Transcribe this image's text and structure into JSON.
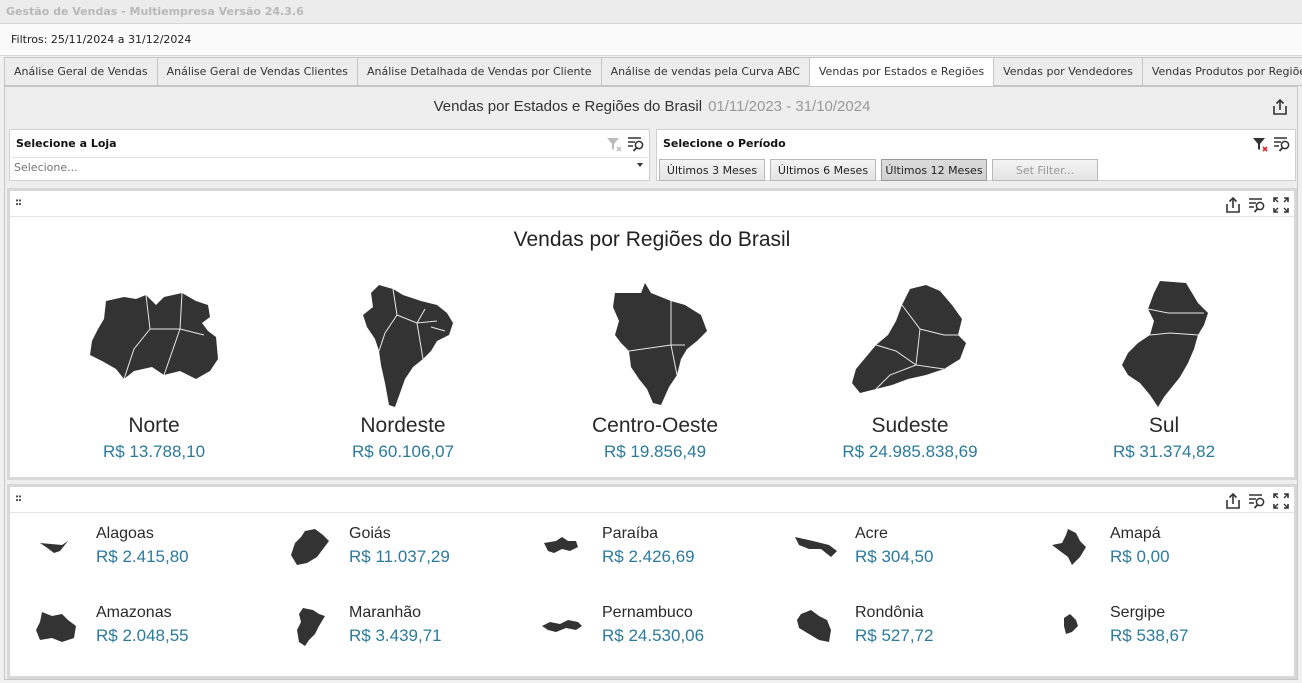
{
  "window": {
    "title": "Gestão de Vendas - Multiempresa Versão 24.3.6"
  },
  "filters": {
    "text": "Filtros: 25/11/2024 a 31/12/2024"
  },
  "tabs": [
    {
      "label": "Análise Geral de Vendas"
    },
    {
      "label": "Análise Geral de Vendas Clientes"
    },
    {
      "label": "Análise Detalhada de Vendas por Cliente"
    },
    {
      "label": "Análise de vendas pela Curva ABC"
    },
    {
      "label": "Vendas por Estados e Regiões",
      "active": true
    },
    {
      "label": "Vendas por Vendedores"
    },
    {
      "label": "Vendas Produtos por Regiões"
    }
  ],
  "dashboard": {
    "title": "Vendas por Estados e Regiões do Brasil",
    "period": "01/11/2023 - 31/10/2024"
  },
  "store_filter": {
    "title": "Selecione a Loja",
    "placeholder": "Selecione..."
  },
  "period_filter": {
    "title": "Selecione o Período",
    "buttons": [
      "Últimos 3 Meses",
      "Últimos 6 Meses",
      "Últimos 12 Meses",
      "Set Filter..."
    ],
    "selected": "Últimos 12 Meses"
  },
  "regions_panel": {
    "title": "Vendas por Regiões do Brasil",
    "regions": [
      {
        "name": "Norte",
        "value": "R$ 13.788,10",
        "icon": "norte-map-icon"
      },
      {
        "name": "Nordeste",
        "value": "R$ 60.106,07",
        "icon": "nordeste-map-icon"
      },
      {
        "name": "Centro-Oeste",
        "value": "R$ 19.856,49",
        "icon": "centro-oeste-map-icon"
      },
      {
        "name": "Sudeste",
        "value": "R$ 24.985.838,69",
        "icon": "sudeste-map-icon"
      },
      {
        "name": "Sul",
        "value": "R$ 31.374,82",
        "icon": "sul-map-icon"
      }
    ]
  },
  "states_panel": {
    "states": [
      {
        "name": "Alagoas",
        "value": "R$ 2.415,80"
      },
      {
        "name": "Goiás",
        "value": "R$ 11.037,29"
      },
      {
        "name": "Paraíba",
        "value": "R$ 2.426,69"
      },
      {
        "name": "Acre",
        "value": "R$ 304,50"
      },
      {
        "name": "Amapá",
        "value": "R$ 0,00"
      },
      {
        "name": "Amazonas",
        "value": "R$ 2.048,55"
      },
      {
        "name": "Maranhão",
        "value": "R$ 3.439,71"
      },
      {
        "name": "Pernambuco",
        "value": "R$ 24.530,06"
      },
      {
        "name": "Rondônia",
        "value": "R$ 527,72"
      },
      {
        "name": "Sergipe",
        "value": "R$ 538,67"
      }
    ]
  },
  "colors": {
    "value_text": "#2c7a9c",
    "map_fill": "#333333",
    "accent_red": "#d9262c"
  }
}
